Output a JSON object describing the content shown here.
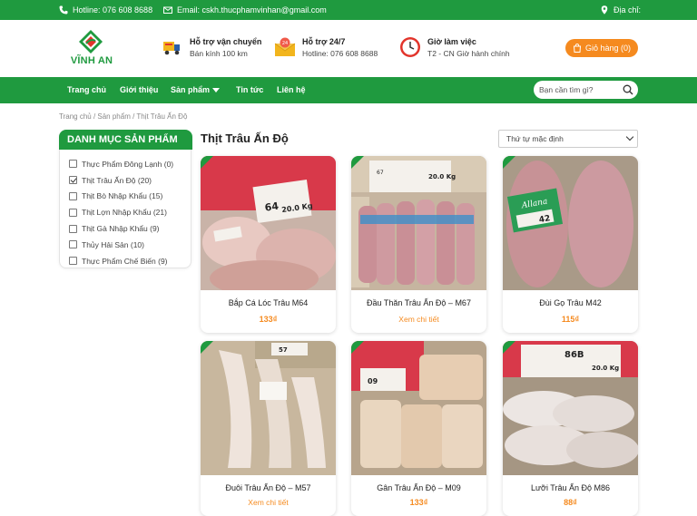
{
  "topbar": {
    "hotline": "Hotline: 076 608 8688",
    "email": "Email: cskh.thucphamvinhan@gmail.com",
    "address": "Địa chỉ:"
  },
  "header": {
    "brand": "VĨNH AN",
    "shipping_title": "Hỗ trợ vận chuyển",
    "shipping_sub": "Bán kính 100 km",
    "support_title": "Hỗ trợ 24/7",
    "support_sub": "Hotline: 076 608 8688",
    "hours_title": "Giờ làm việc",
    "hours_sub": "T2 - CN Giờ hành chính",
    "cart_label": "Giỏ hàng (0)"
  },
  "nav": {
    "items": [
      "Trang chủ",
      "Giới thiệu",
      "Sản phẩm",
      "Tin tức",
      "Liên hệ"
    ],
    "search_placeholder": "Bạn cần tìm gì?"
  },
  "breadcrumb": "Trang chủ / Sản phẩm / Thịt Trâu Ấn Độ",
  "sidebar": {
    "title": "DANH MỤC SẢN PHẨM",
    "categories": [
      {
        "label": "Thực Phẩm Đông Lạnh (0)",
        "checked": false
      },
      {
        "label": "Thịt Trâu Ấn Độ (20)",
        "checked": true
      },
      {
        "label": "Thịt Bò Nhập Khẩu (15)",
        "checked": false
      },
      {
        "label": "Thịt Lợn Nhập Khẩu (21)",
        "checked": false
      },
      {
        "label": "Thịt Gà Nhập Khẩu (9)",
        "checked": false
      },
      {
        "label": "Thủy Hải Sản (10)",
        "checked": false
      },
      {
        "label": "Thực Phẩm Chế Biến (9)",
        "checked": false
      }
    ]
  },
  "main": {
    "title": "Thịt Trâu Ấn Độ",
    "sort_label": "Thứ tự mặc định"
  },
  "products": [
    {
      "name": "Bắp Cá Lóc Trâu M64",
      "price": "133₫"
    },
    {
      "name": "Đầu Thăn Trâu Ấn Độ – M67",
      "price": "Xem chi tiết"
    },
    {
      "name": "Đùi Gọ Trâu M42",
      "price": "115₫"
    },
    {
      "name": "Đuôi Trâu Ấn Độ – M57",
      "price": "Xem chi tiết"
    },
    {
      "name": "Gân Trâu Ấn Độ – M09",
      "price": "133₫"
    },
    {
      "name": "Lưỡi Trâu Ấn Độ M86",
      "price": "88₫"
    }
  ],
  "product_labels": {
    "m64_code": "64",
    "m64_weight": "20.0 Kg",
    "m67_code": "67",
    "m67_weight": "20.0 Kg",
    "m42_code": "42",
    "m57_code": "57",
    "m09_code": "09",
    "m86_code": "86B",
    "m86_weight": "20.0 Kg"
  },
  "colors": {
    "brand_green": "#1f9a3f",
    "accent_orange": "#f58a1f"
  }
}
